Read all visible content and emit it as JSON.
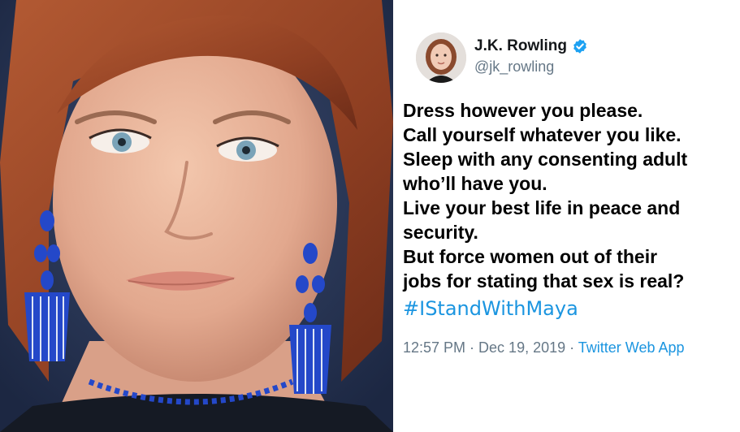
{
  "tweet": {
    "display_name": "J.K. Rowling",
    "handle": "@jk_rowling",
    "verified": true,
    "body_lines": [
      "Dress however you please.",
      "Call yourself whatever you like.",
      "Sleep with any consenting adult",
      "who’ll have you.",
      "Live your best life in peace and",
      "security.",
      "But force women out of their",
      "jobs for stating that sex is real?"
    ],
    "hashtag": "#IStandWithMaya",
    "time": "12:57 PM",
    "separator": " · ",
    "date": "Dec 19, 2019",
    "source": "Twitter Web App"
  },
  "colors": {
    "link": "#1b95e0",
    "secondary_text": "#657786",
    "body_text": "#000000",
    "verified_badge": "#1da1f2",
    "photo_background": "#23324e",
    "earring_blue": "#2448c9"
  },
  "icons": {
    "verified": "verified-badge-icon"
  }
}
